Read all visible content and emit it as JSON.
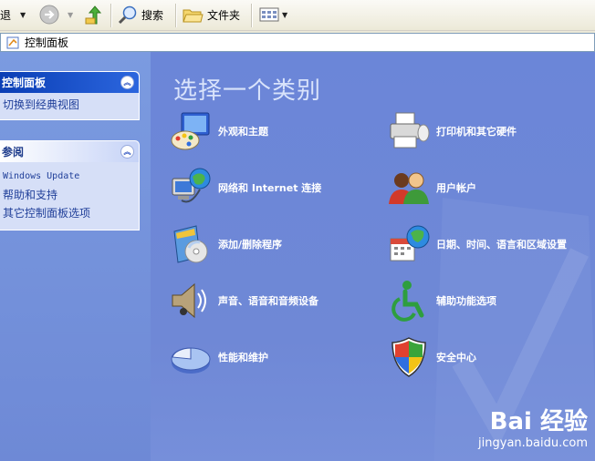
{
  "toolbar": {
    "back_label": "退",
    "search_label": "搜索",
    "folders_label": "文件夹"
  },
  "address": {
    "value": "控制面板"
  },
  "sidebar": {
    "panel1": {
      "title": "控制面板",
      "links": [
        "切换到经典视图"
      ]
    },
    "panel2": {
      "title": "参阅",
      "links": [
        "Windows Update",
        "帮助和支持",
        "其它控制面板选项"
      ]
    }
  },
  "main": {
    "heading": "选择一个类别",
    "categories": [
      {
        "label": "外观和主题",
        "icon": "appearance-themes-icon"
      },
      {
        "label": "打印机和其它硬件",
        "icon": "printer-icon"
      },
      {
        "label": "网络和 Internet 连接",
        "icon": "network-icon"
      },
      {
        "label": "用户帐户",
        "icon": "user-accounts-icon"
      },
      {
        "label": "添加/删除程序",
        "icon": "add-remove-programs-icon"
      },
      {
        "label": "日期、时间、语言和区域设置",
        "icon": "date-time-icon"
      },
      {
        "label": "声音、语音和音频设备",
        "icon": "sound-icon"
      },
      {
        "label": "辅助功能选项",
        "icon": "accessibility-icon"
      },
      {
        "label": "性能和维护",
        "icon": "performance-icon"
      },
      {
        "label": "安全中心",
        "icon": "security-center-icon"
      }
    ]
  },
  "watermark": {
    "logo": "Bai 经验",
    "url": "jingyan.baidu.com"
  },
  "colors": {
    "main_bg": "#6F88D6",
    "sidebar_bg": "#7B9BE0",
    "panel_head_dark": "#0A3EB5",
    "link_text": "#21409A"
  }
}
